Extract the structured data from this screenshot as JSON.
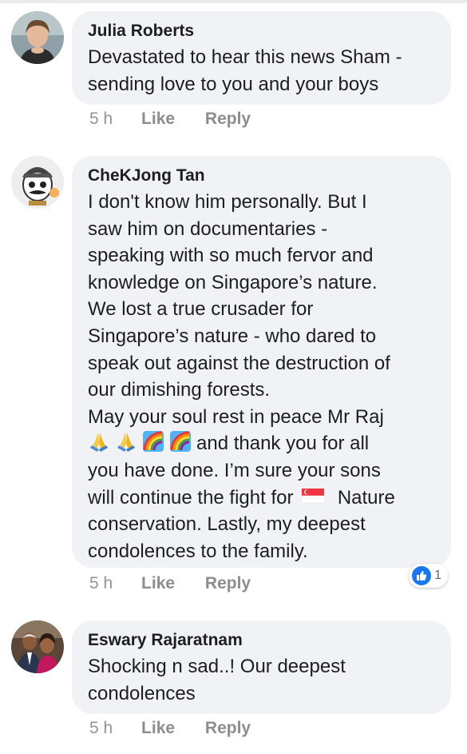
{
  "comments": [
    {
      "author": "Julia Roberts",
      "lines": [
        "Devastated to hear this news Sham -",
        "sending love to you and your boys"
      ],
      "time": "5 h",
      "like_label": "Like",
      "reply_label": "Reply"
    },
    {
      "author": "CheKJong Tan",
      "lines": [
        "I don't know him personally.  But I",
        "saw him on documentaries -",
        "speaking with so much fervor and",
        "knowledge on Singapore’s nature.",
        "We lost a true crusader for",
        "Singapore’s nature - who dared to",
        "speak out against the destruction of",
        "our dimishing forests.",
        "May your soul rest in peace Mr Raj"
      ],
      "emoji_line_text": "and thank you for all",
      "lines_after": [
        "you have done. I’m sure your sons"
      ],
      "flag_line_prefix": "will continue the fight for",
      "flag_line_suffix": "Nature",
      "lines_end": [
        "conservation.   Lastly, my deepest",
        "condolences to the family."
      ],
      "time": "5 h",
      "like_label": "Like",
      "reply_label": "Reply",
      "reaction_count": "1"
    },
    {
      "author": "Eswary Rajaratnam",
      "lines": [
        "Shocking n sad..! Our deepest",
        "condolences"
      ],
      "time": "5 h",
      "like_label": "Like",
      "reply_label": "Reply"
    }
  ],
  "icons": {
    "emoji_sequence": [
      "folded-hands-icon",
      "folded-hands-icon",
      "rainbow-icon",
      "rainbow-icon"
    ],
    "flag": "singapore-flag-icon",
    "reaction": "thumbs-up-icon"
  },
  "colors": {
    "bubble": "#f0f2f5",
    "meta": "#90949c",
    "like_blue": "#1877f2"
  }
}
